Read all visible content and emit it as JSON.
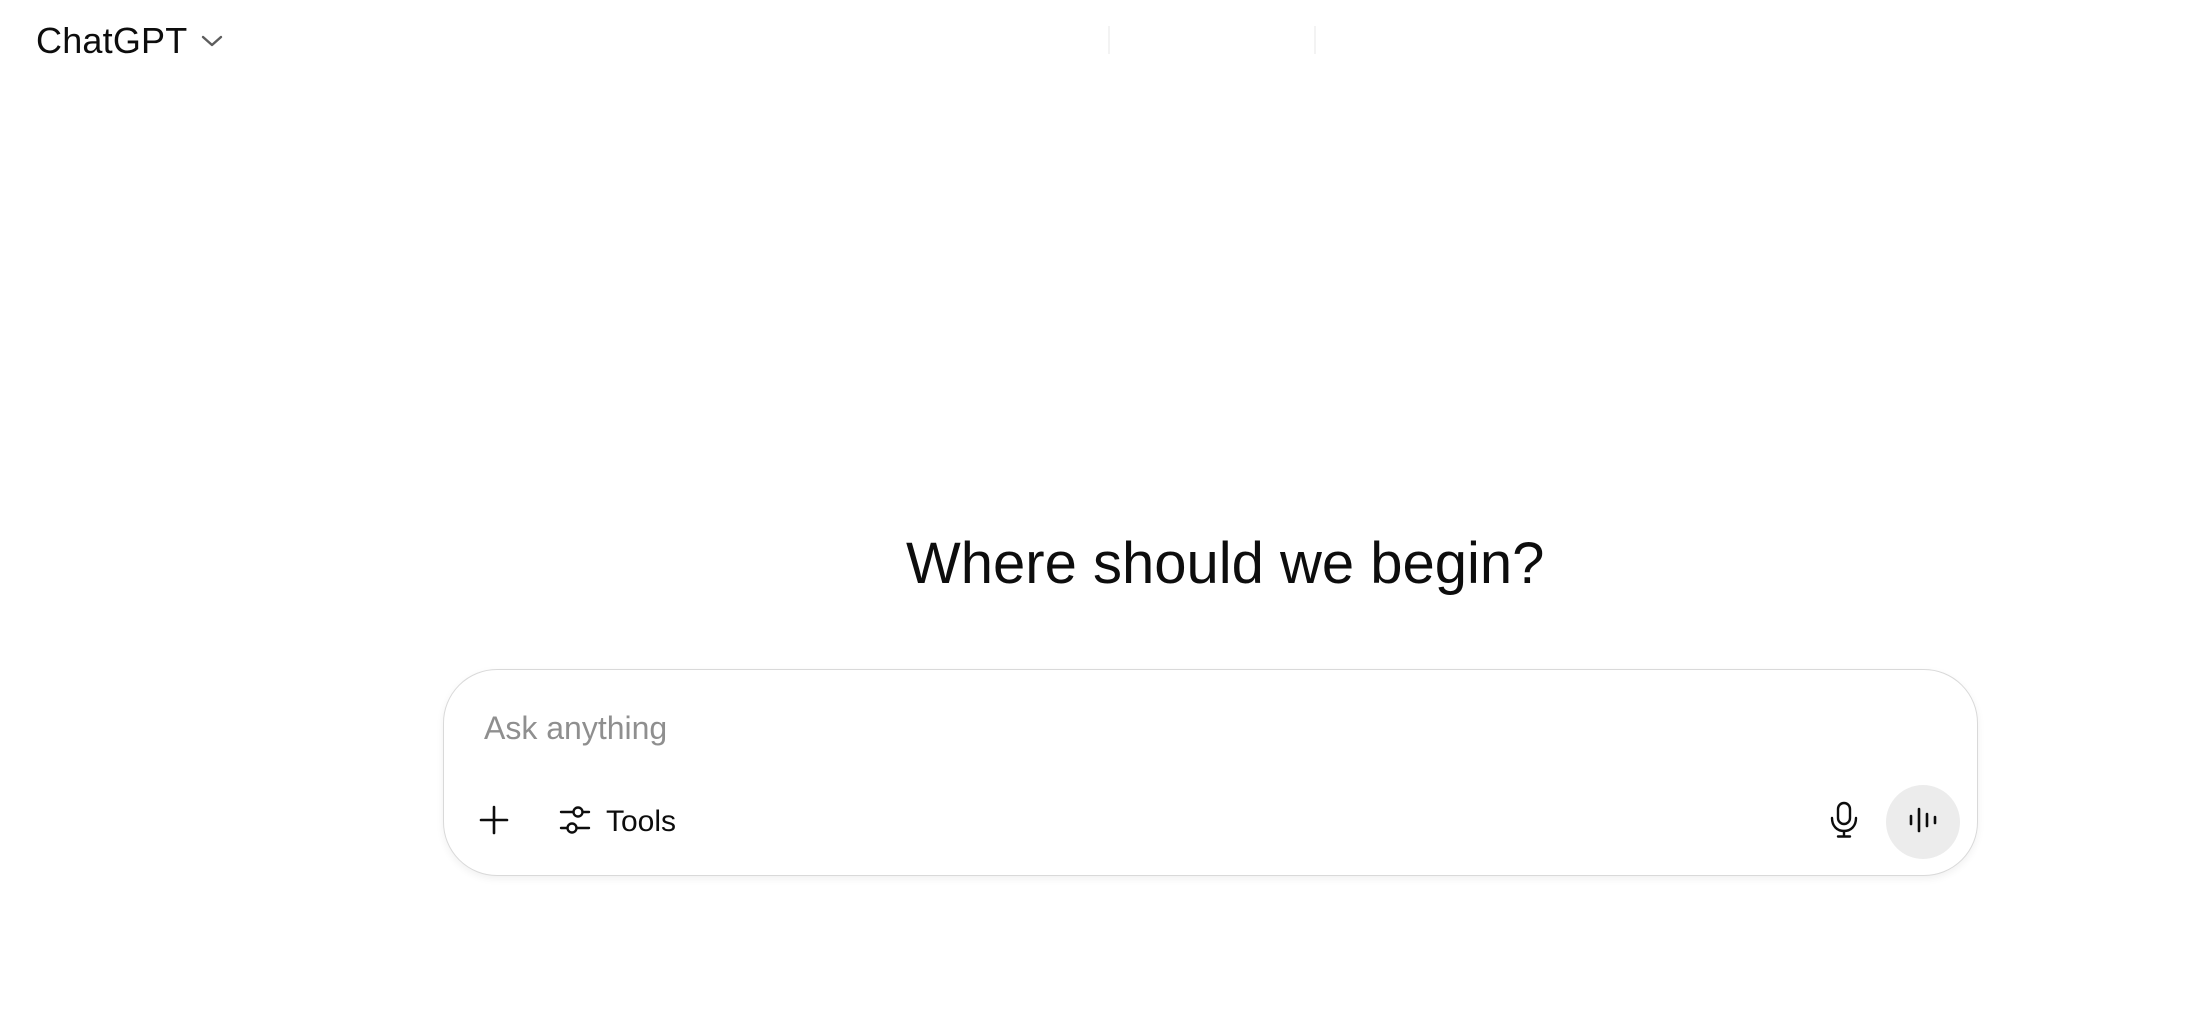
{
  "header": {
    "model_name": "ChatGPT",
    "model_dropdown_icon": "chevron-down-icon"
  },
  "main": {
    "heading": "Where should we begin?"
  },
  "composer": {
    "placeholder": "Ask anything",
    "value": "",
    "add_icon": "plus-icon",
    "tools_icon": "sliders-icon",
    "tools_label": "Tools",
    "mic_icon": "microphone-icon",
    "voice_icon": "voice-waveform-icon"
  },
  "colors": {
    "text": "#0d0d0d",
    "placeholder": "#8f8f8f",
    "border": "#d9d9d9",
    "voice_button_bg": "#ececec",
    "background": "#ffffff"
  }
}
